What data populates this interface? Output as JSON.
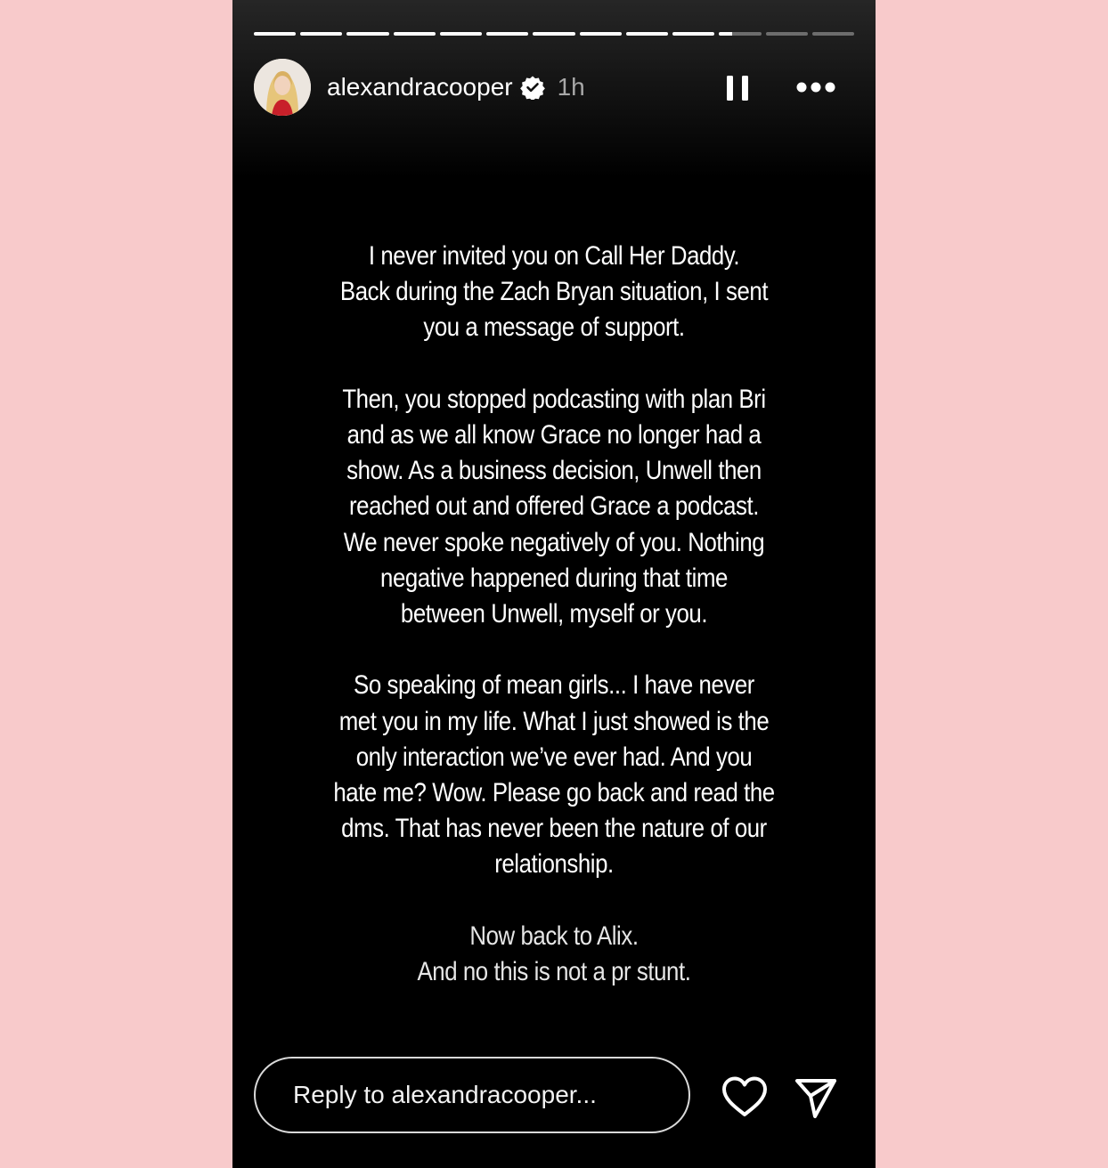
{
  "story": {
    "progress_segments": [
      1,
      1,
      1,
      1,
      1,
      1,
      1,
      1,
      1,
      1,
      0.3,
      0,
      0
    ],
    "username": "alexandracooper",
    "time_ago": "1h",
    "paragraphs": [
      [
        "I never invited you on Call Her Daddy.",
        "Back during the Zach Bryan situation, I sent",
        "you a message of support."
      ],
      [
        "Then, you stopped podcasting with plan Bri",
        "and as we all know Grace no longer had a",
        "show. As a business decision, Unwell then",
        "reached out and offered Grace a podcast.",
        "We never spoke negatively of you. Nothing",
        "negative happened during that time",
        "between Unwell, myself or you."
      ],
      [
        "So speaking of mean girls... I have never",
        "met you in my life. What I just showed is the",
        "only interaction we’ve ever had. And you",
        "hate me? Wow. Please go back and read the",
        "dms. That has never been the nature of our",
        "relationship."
      ],
      [
        "Now back to Alix.",
        "And no this is not a pr stunt."
      ]
    ]
  },
  "footer": {
    "reply_placeholder": "Reply to alexandracooper..."
  },
  "icons": {
    "verified": "verified-badge-icon",
    "pause": "pause-icon",
    "more": "more-options-icon",
    "heart": "heart-icon",
    "send": "send-icon"
  }
}
